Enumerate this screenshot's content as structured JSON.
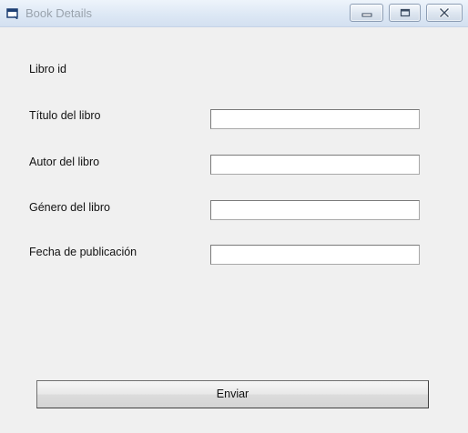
{
  "window": {
    "title": "Book Details"
  },
  "form": {
    "fields": [
      {
        "label": "Libro id",
        "value": ""
      },
      {
        "label": "Título del libro",
        "value": ""
      },
      {
        "label": "Autor del libro",
        "value": ""
      },
      {
        "label": "Género del libro",
        "value": ""
      },
      {
        "label": "Fecha de publicación",
        "value": ""
      }
    ],
    "submit_label": "Enviar"
  },
  "icons": {
    "app": "window-app-icon",
    "minimize": "minimize-icon",
    "maximize": "maximize-icon",
    "close": "close-icon"
  }
}
